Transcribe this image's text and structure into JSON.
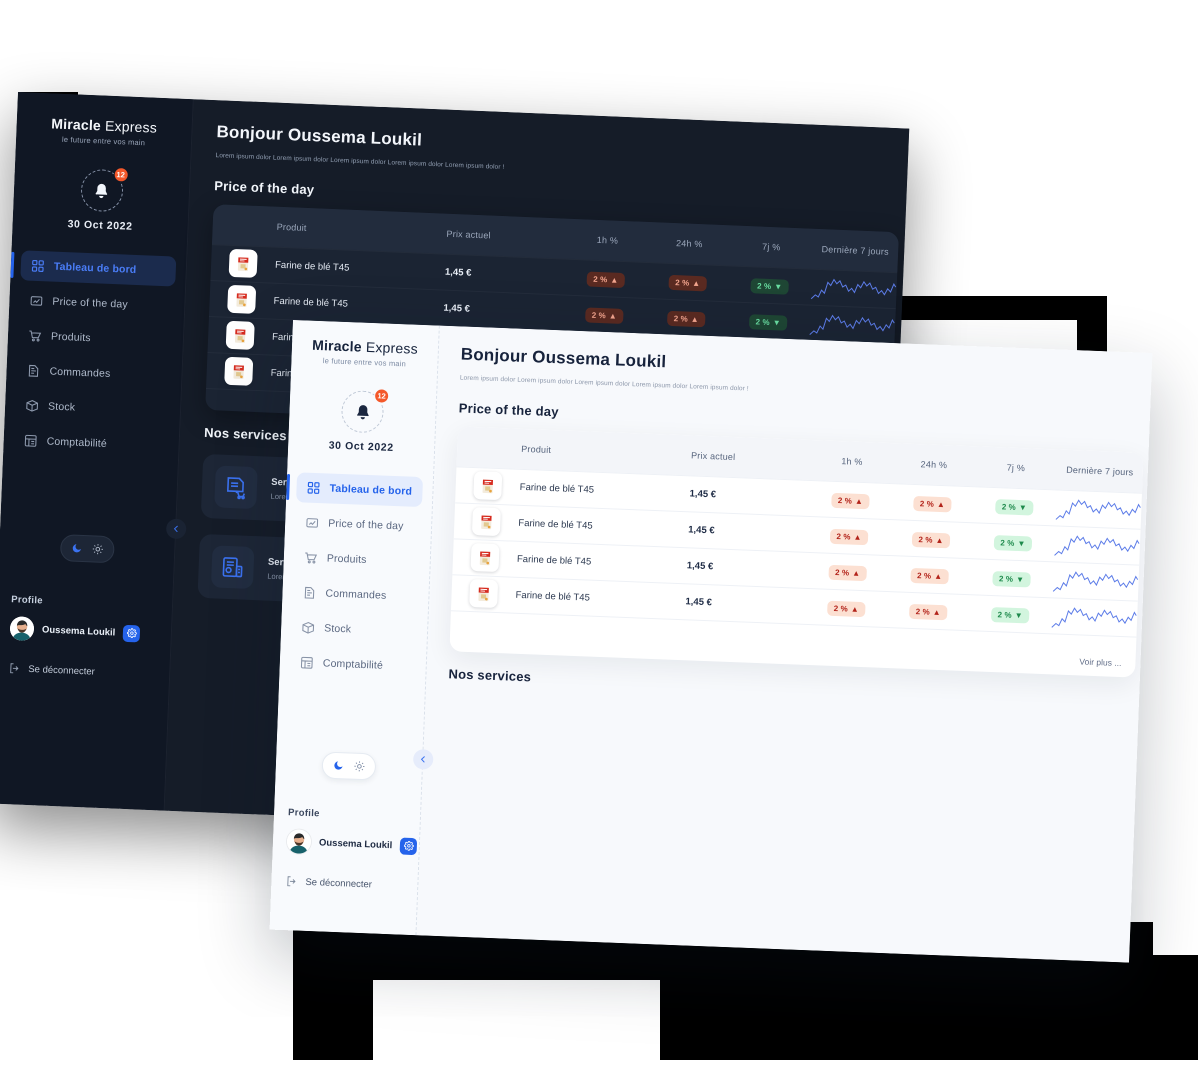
{
  "brand": {
    "name_bold": "Miracle",
    "name_light": "Express",
    "tagline": "le future entre vos main"
  },
  "notification": {
    "count": "12",
    "date": "30 Oct 2022",
    "icon": "bell-icon"
  },
  "sidebar": {
    "items": [
      {
        "label": "Tableau de bord",
        "icon": "grid-icon",
        "active": true
      },
      {
        "label": "Price of the day",
        "icon": "price-tag-icon",
        "active": false
      },
      {
        "label": "Produits",
        "icon": "cart-icon",
        "active": false
      },
      {
        "label": "Commandes",
        "icon": "order-doc-icon",
        "active": false
      },
      {
        "label": "Stock",
        "icon": "box-icon",
        "active": false
      },
      {
        "label": "Comptabilité",
        "icon": "accounting-icon",
        "active": false
      }
    ],
    "theme_toggle": {
      "dark_icon": "moon-icon",
      "light_icon": "sun-icon",
      "active": "dark"
    },
    "profile_title": "Profile",
    "profile_name": "Oussema Loukil",
    "settings_icon": "gear-icon",
    "logout_label": "Se déconnecter",
    "logout_icon": "logout-icon"
  },
  "main": {
    "greeting": "Bonjour Oussema Loukil",
    "lorem": "Lorem ipsum dolor Lorem ipsum dolor Lorem ipsum dolor Lorem ipsum dolor Lorem ipsum dolor !",
    "price_section_title": "Price of the day",
    "services_section_title": "Nos services",
    "voir_plus": "Voir plus ...",
    "collapse_icon": "chevron-left-icon"
  },
  "table": {
    "headers": {
      "produit": "Produit",
      "prix": "Prix actuel",
      "h1": "1h %",
      "h24": "24h %",
      "j7": "7j %",
      "derniere": "Dernière 7 jours"
    },
    "rows": [
      {
        "image": "flour-bag-icon",
        "name": "Farine de blé T45",
        "price": "1,45 €",
        "h1": "2 %",
        "h1_dir": "up",
        "h24": "2 %",
        "h24_dir": "up",
        "j7": "2 %",
        "j7_dir": "down"
      },
      {
        "image": "flour-bag-icon",
        "name": "Farine de blé T45",
        "price": "1,45 €",
        "h1": "2 %",
        "h1_dir": "up",
        "h24": "2 %",
        "h24_dir": "up",
        "j7": "2 %",
        "j7_dir": "down"
      },
      {
        "image": "flour-bag-icon",
        "name": "Farine de blé T45",
        "price": "1,45 €",
        "h1": "2 %",
        "h1_dir": "up",
        "h24": "2 %",
        "h24_dir": "up",
        "j7": "2 %",
        "j7_dir": "down"
      },
      {
        "image": "flour-bag-icon",
        "name": "Farine de blé T45",
        "price": "1,45 €",
        "h1": "2 %",
        "h1_dir": "up",
        "h24": "2 %",
        "h24_dir": "up",
        "j7": "2 %",
        "j7_dir": "down"
      }
    ]
  },
  "services": [
    {
      "icon": "invoice-cart-icon",
      "title": "Services",
      "subtitle": "Lorem ipsum dolor"
    },
    {
      "icon": "analytics-icon",
      "title": "Services",
      "subtitle": "Lorem ipsum dolor"
    }
  ],
  "colors": {
    "accent": "#2563EB",
    "badge_red": "#F4582A",
    "pill_up_bg": "#FCE0D2",
    "pill_up_fg": "#B3231A",
    "pill_down_bg": "#D2F5DE",
    "pill_down_fg": "#1E8A4C",
    "dark_bg": "#151C28",
    "dark_side": "#101724",
    "light_bg": "#F7F9FC"
  }
}
